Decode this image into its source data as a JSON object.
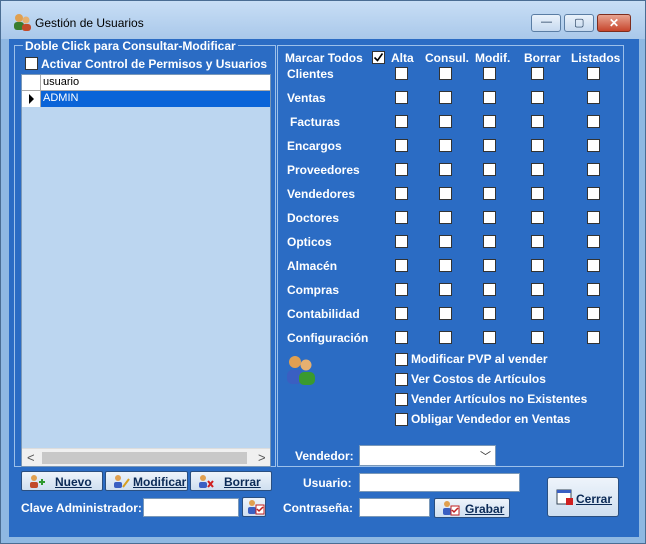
{
  "window": {
    "title": "Gestión de Usuarios",
    "min_glyph": "—",
    "max_glyph": "▢",
    "close_glyph": "✕"
  },
  "left_panel": {
    "group_label": "Doble Click para Consultar-Modificar",
    "permission_control_label": "Activar Control de Permisos y Usuarios",
    "grid_column": "usuario",
    "grid_rows": [
      "ADMIN"
    ],
    "scroll_left": "<",
    "scroll_right": ">"
  },
  "buttons": {
    "nuevo": "Nuevo",
    "modificar": "Modificar",
    "borrar": "Borrar",
    "grabar": "Grabar",
    "cerrar": "Cerrar"
  },
  "admin_key_label": "Clave Administrador:",
  "permissions": {
    "mark_all_label": "Marcar Todos",
    "columns": [
      "Alta",
      "Consul.",
      "Modif.",
      "Borrar",
      "Listados"
    ],
    "rows": [
      "Clientes",
      "Ventas",
      "Facturas",
      "Encargos",
      "Proveedores",
      "Vendedores",
      "Doctores",
      "Opticos",
      "Almacén",
      "Compras",
      "Contabilidad",
      "Configuración"
    ]
  },
  "options": [
    "Modificar PVP al vender",
    "Ver Costos de Artículos",
    "Vender Artículos no Existentes",
    "Obligar Vendedor en Ventas"
  ],
  "fields": {
    "vendedor_label": "Vendedor:",
    "usuario_label": "Usuario:",
    "password_label": "Contraseña:",
    "dropdown_glyph": "﹀"
  },
  "colors": {
    "client_background": "#2b6cc4",
    "selected_row": "#0a64d8"
  }
}
